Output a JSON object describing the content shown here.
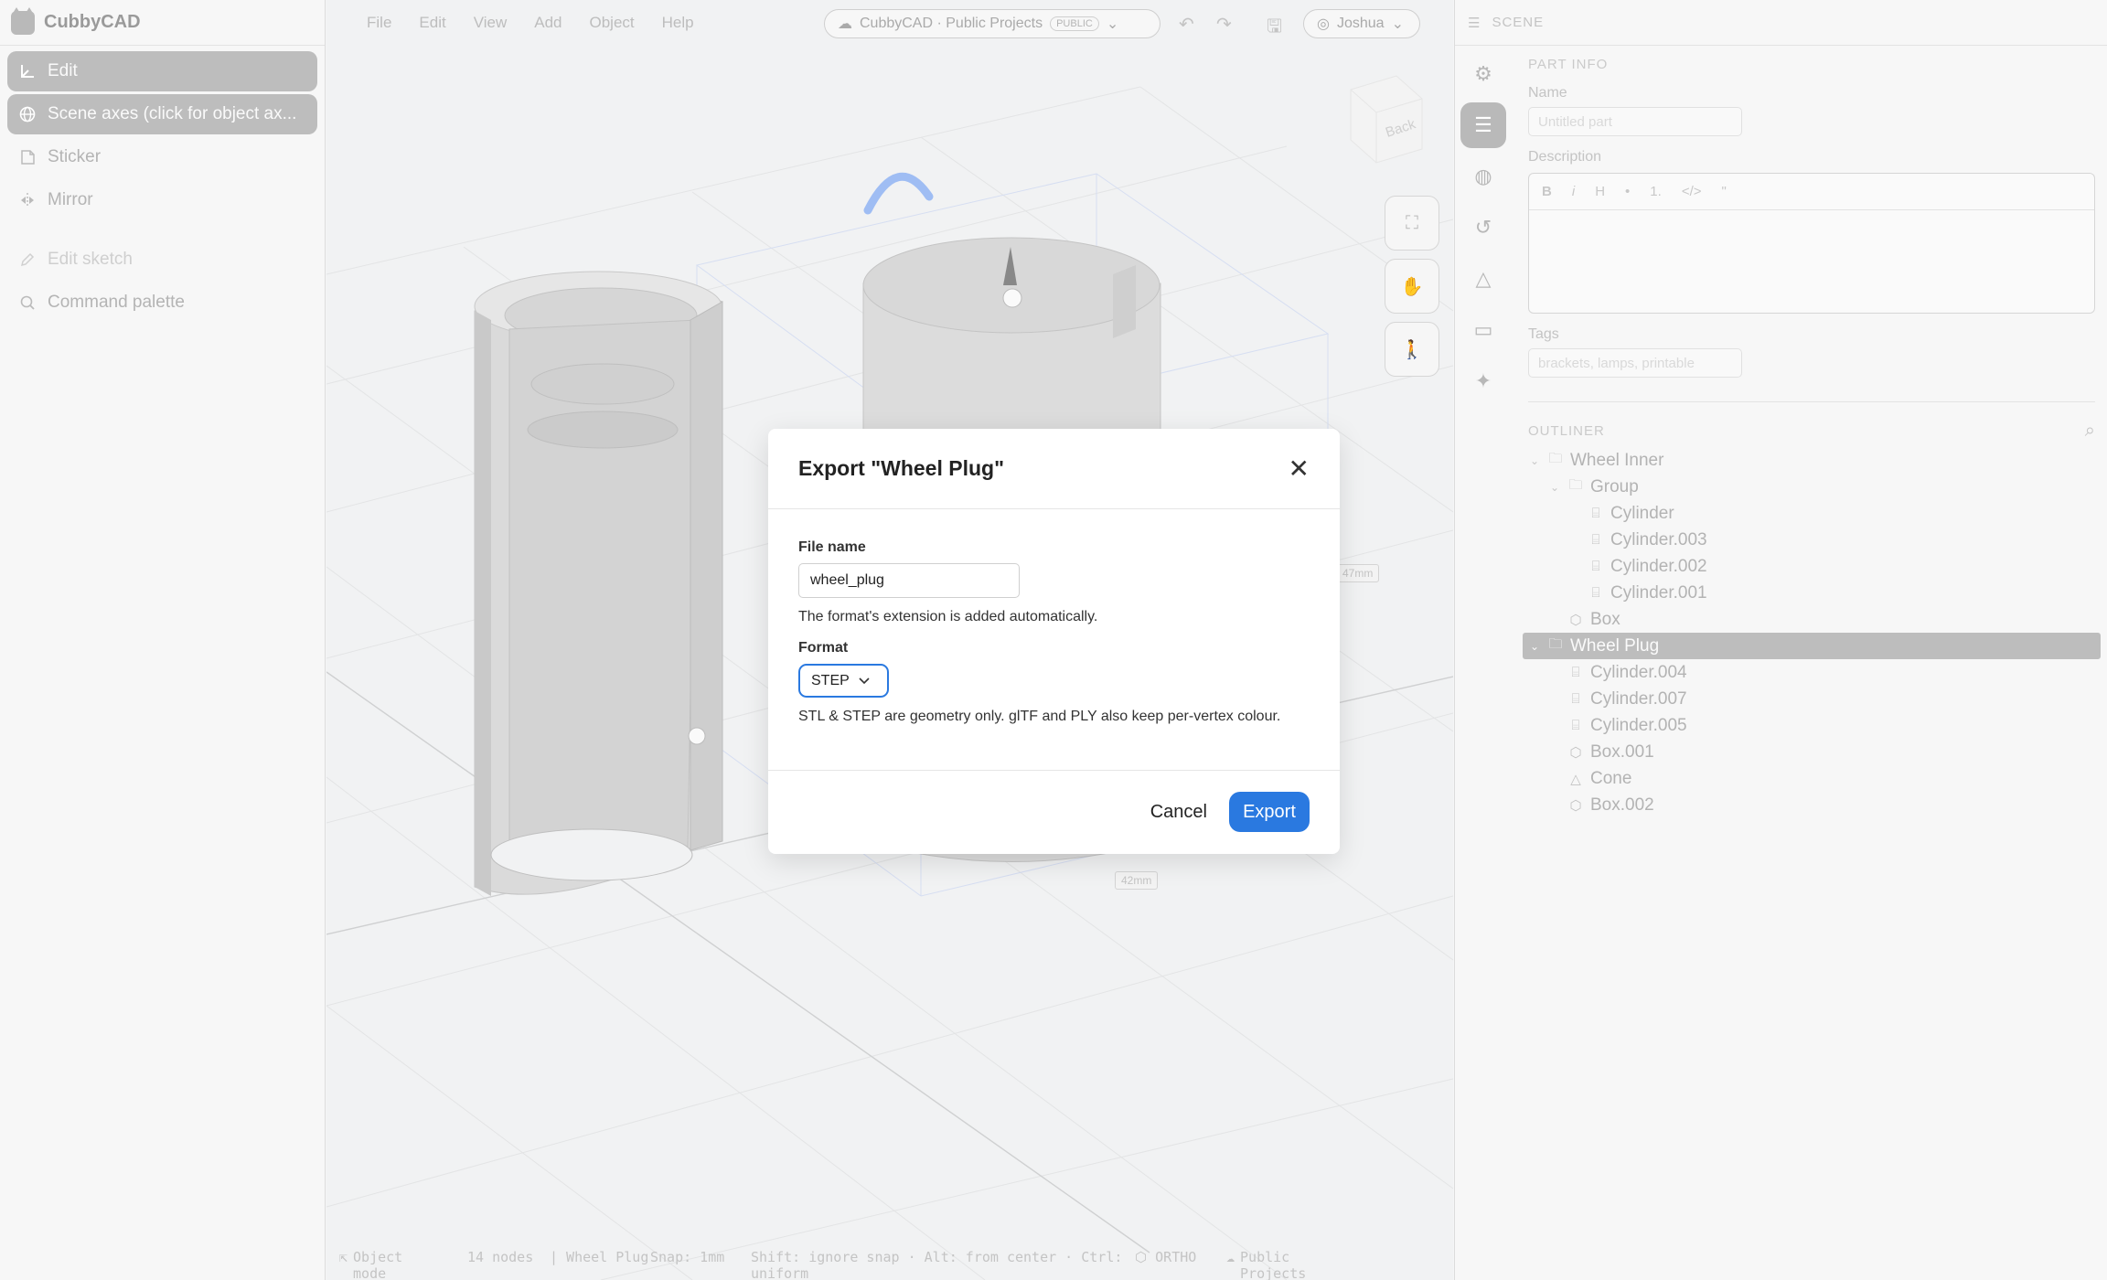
{
  "brand": {
    "name": "CubbyCAD"
  },
  "sidebar": {
    "items": [
      {
        "label": "Edit",
        "icon": "axis-icon"
      },
      {
        "label": "Scene axes (click for object ax...",
        "icon": "globe-icon"
      },
      {
        "label": "Sticker",
        "icon": "sticker-icon"
      },
      {
        "label": "Mirror",
        "icon": "mirror-icon"
      }
    ],
    "items2": [
      {
        "label": "Edit sketch",
        "icon": "pencil-icon"
      },
      {
        "label": "Command palette",
        "icon": "search-icon"
      }
    ]
  },
  "menubar": {
    "file": "File",
    "edit": "Edit",
    "view": "View",
    "add": "Add",
    "object": "Object",
    "help": "Help"
  },
  "project": {
    "label": "CubbyCAD · Public Projects",
    "badge": "PUBLIC"
  },
  "user": {
    "name": "Joshua"
  },
  "viewcube": {
    "face": "Back"
  },
  "dimensions": {
    "d1": "47mm",
    "d2": "42mm"
  },
  "statusbar": {
    "mode": "Object mode",
    "nodes": "14 nodes",
    "selection": "| Wheel Plug",
    "snap": "Snap: 1mm",
    "hint": "Shift: ignore snap · Alt: from center · Ctrl: uniform",
    "view": "ORTHO",
    "project": "Public Projects"
  },
  "rpanel": {
    "header": "SCENE",
    "part_info": "PART INFO",
    "name_label": "Name",
    "name_placeholder": "Untitled part",
    "description_label": "Description",
    "md_tools": [
      "B",
      "i",
      "H",
      "•",
      "1.",
      "</>",
      "\""
    ],
    "tags_label": "Tags",
    "tags_placeholder": "brackets, lamps, printable",
    "outliner": "OUTLINER"
  },
  "outliner": [
    {
      "label": "Wheel Inner",
      "type": "folder",
      "depth": 0,
      "chev": true
    },
    {
      "label": "Group",
      "type": "folder",
      "depth": 1,
      "chev": true
    },
    {
      "label": "Cylinder",
      "type": "cylinder",
      "depth": 2
    },
    {
      "label": "Cylinder.003",
      "type": "cylinder",
      "depth": 2
    },
    {
      "label": "Cylinder.002",
      "type": "cylinder",
      "depth": 2
    },
    {
      "label": "Cylinder.001",
      "type": "cylinder",
      "depth": 2
    },
    {
      "label": "Box",
      "type": "box",
      "depth": 1
    },
    {
      "label": "Wheel Plug",
      "type": "folder",
      "depth": 0,
      "chev": true,
      "selected": true
    },
    {
      "label": "Cylinder.004",
      "type": "cylinder",
      "depth": 1
    },
    {
      "label": "Cylinder.007",
      "type": "cylinder",
      "depth": 1
    },
    {
      "label": "Cylinder.005",
      "type": "cylinder",
      "depth": 1
    },
    {
      "label": "Box.001",
      "type": "box",
      "depth": 1
    },
    {
      "label": "Cone",
      "type": "cone",
      "depth": 1
    },
    {
      "label": "Box.002",
      "type": "box",
      "depth": 1
    }
  ],
  "modal": {
    "title": "Export \"Wheel Plug\"",
    "file_label": "File name",
    "file_value": "wheel_plug",
    "ext_hint": "The format's extension is added automatically.",
    "format_label": "Format",
    "format_value": "STEP",
    "format_hint": "STL & STEP are geometry only. glTF and PLY also keep per-vertex colour.",
    "cancel": "Cancel",
    "export": "Export"
  },
  "colors": {
    "accent": "#2a79e0",
    "selection": "#bdbdbd",
    "overlay_text": "#b3b3b3"
  }
}
